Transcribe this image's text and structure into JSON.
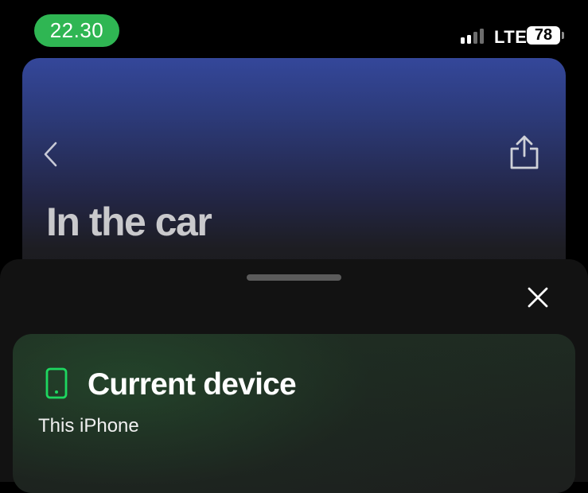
{
  "status_bar": {
    "time": "22.30",
    "time_pill_color": "#2fb653",
    "signal_bars_active": 2,
    "signal_bars_total": 4,
    "network": "LTE",
    "battery_percent": "78"
  },
  "playlist": {
    "title": "In the car",
    "gradient_top_color": "#34479a",
    "back_icon": "chevron-left-icon",
    "share_icon": "share-icon"
  },
  "sheet": {
    "grabber_icon": "grabber-handle",
    "close_icon": "close-icon",
    "current_device": {
      "heading": "Current device",
      "name": "This iPhone",
      "icon": "phone-icon",
      "accent_color": "#1ed760"
    }
  }
}
